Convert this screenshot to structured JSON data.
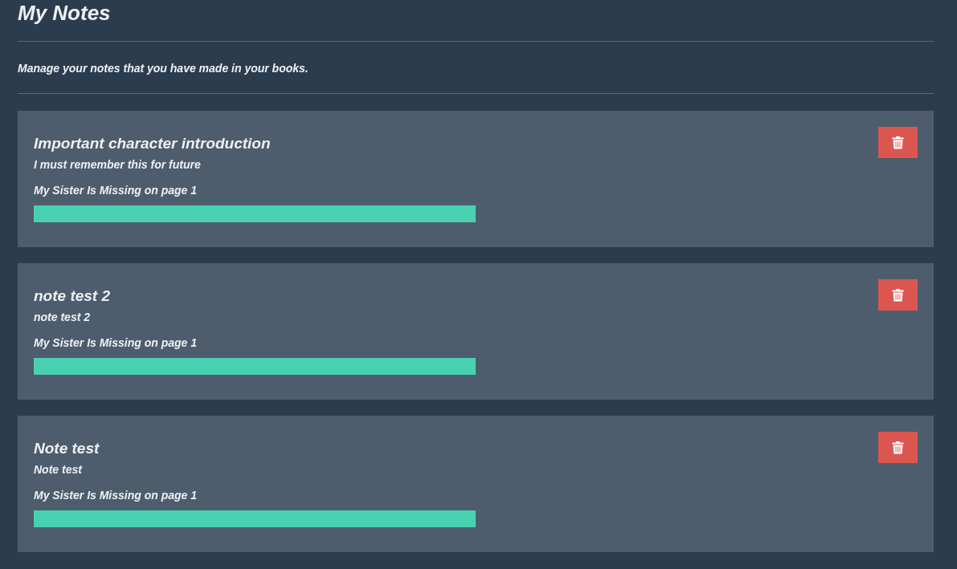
{
  "page": {
    "title": "My Notes",
    "subtitle": "Manage your notes that you have made in your books."
  },
  "notes": [
    {
      "title": "Important character introduction",
      "body": "I must remember this for future",
      "source": "My Sister Is Missing on page 1",
      "color": "#48d1b0"
    },
    {
      "title": "note test 2",
      "body": "note test 2",
      "source": "My Sister Is Missing on page 1",
      "color": "#48d1b0"
    },
    {
      "title": "Note test",
      "body": "Note test",
      "source": "My Sister Is Missing on page 1",
      "color": "#48d1b0"
    }
  ]
}
